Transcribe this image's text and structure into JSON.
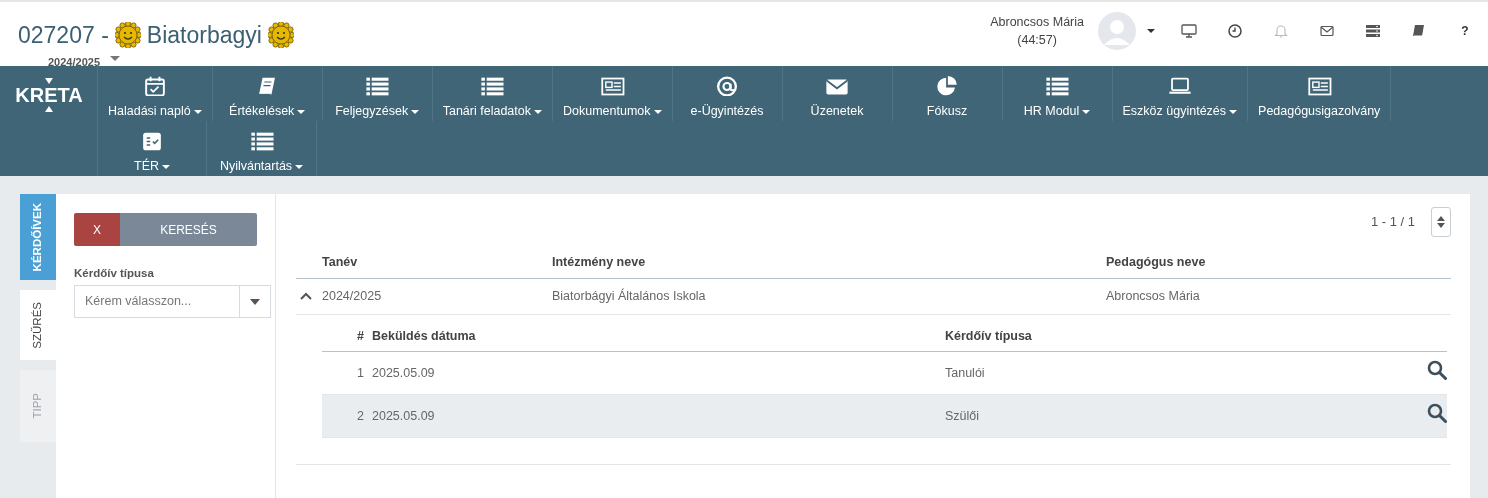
{
  "header": {
    "logo": "KRETA",
    "code": "027207 -",
    "name": "Biatorbagyi",
    "school_year": "2024/2025",
    "user": {
      "name": "Abroncsos Mária",
      "session": "(44:57)"
    },
    "help": "?"
  },
  "menu_rows": [
    [
      {
        "label": "Haladási napló",
        "dropdown": true
      },
      {
        "label": "Értékelések",
        "dropdown": true
      },
      {
        "label": "Feljegyzések",
        "dropdown": true
      },
      {
        "label": "Tanári feladatok",
        "dropdown": true
      },
      {
        "label": "Dokumentumok",
        "dropdown": true
      },
      {
        "label": "e-Ügyintézés",
        "dropdown": false
      },
      {
        "label": "Üzenetek",
        "dropdown": false
      },
      {
        "label": "Fókusz",
        "dropdown": false
      },
      {
        "label": "HR Modul",
        "dropdown": true
      },
      {
        "label": "Eszköz ügyintézés",
        "dropdown": true
      },
      {
        "label": "Pedagógusigazolvány",
        "dropdown": false
      }
    ],
    [
      {
        "label": "TÉR",
        "dropdown": true
      },
      {
        "label": "Nyilvántartás",
        "dropdown": true
      }
    ]
  ],
  "side_tabs": [
    {
      "label": "KÉRDŐÍVEK",
      "kind": "main",
      "selected": true
    },
    {
      "label": "SZŰRÉS",
      "kind": "panel",
      "selected": true
    },
    {
      "label": "TIPP",
      "kind": "panel",
      "selected": false
    }
  ],
  "filter": {
    "clear_button": "X",
    "search_button": "KERESÉS",
    "fields": [
      {
        "label": "Kérdőív típusa",
        "placeholder": "Kérem válasszon..."
      }
    ]
  },
  "grid": {
    "pager": "1 - 1 / 1",
    "columns": [
      "Tanév",
      "Intézmény neve",
      "Pedagógus neve"
    ],
    "rows": [
      {
        "cells": [
          "2024/2025",
          "Biatorbágyi Általános Iskola",
          "Abroncsos Mária"
        ],
        "expanded": true,
        "detail": {
          "columns": [
            "#",
            "Beküldés dátuma",
            "Kérdőív típusa"
          ],
          "rows": [
            {
              "cells": [
                "1",
                "2025.05.09",
                "Tanulói"
              ]
            },
            {
              "cells": [
                "2",
                "2025.05.09",
                "Szülői"
              ]
            }
          ]
        }
      }
    ]
  }
}
